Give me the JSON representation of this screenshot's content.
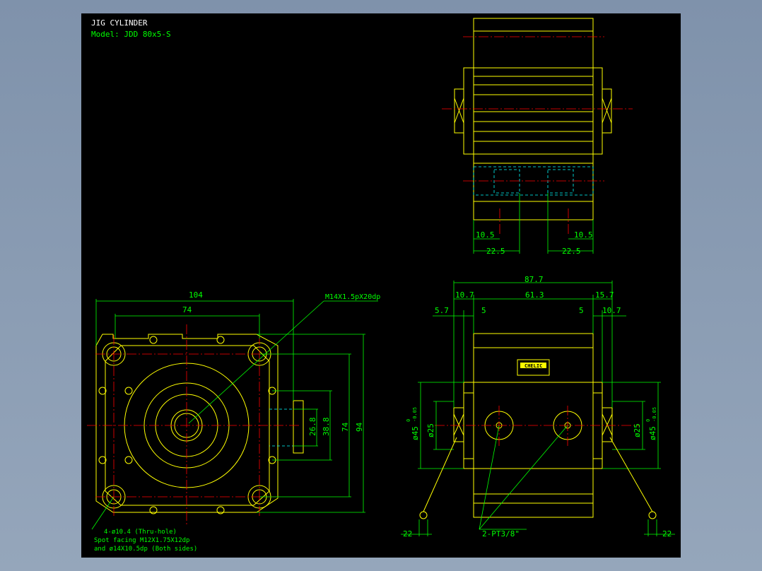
{
  "title": {
    "heading": "JIG CYLINDER",
    "model": "Model:  JDD 80x5-S"
  },
  "colors": {
    "outline": "#ffff00",
    "dimension": "#00ff00",
    "centerline": "#ff0000",
    "hidden": "#00ffff",
    "background": "#000000"
  },
  "top_right_view": {
    "dim_left_inner": "10.5",
    "dim_left_outer": "22.5",
    "dim_right_inner": "10.5",
    "dim_right_outer": "22.5"
  },
  "front_view": {
    "dim_width_total": "104",
    "dim_width_bolt": "74",
    "dim_h_26": "26.8",
    "dim_h_38": "38.8",
    "dim_h_74": "74",
    "dim_h_94": "94",
    "leader_thread": "M14X1.5pX20dp",
    "note_line1": "4-ø10.4 (Thru-hole)",
    "note_line2": "Spot facing  M12X1.75X12dp",
    "note_line3": "and ø14X10.5dp (Both sides)"
  },
  "side_view": {
    "dim_total": "87.7",
    "dim_left": "10.7",
    "dim_mid": "61.3",
    "dim_right": "15.7",
    "dim_5_7": "5.7",
    "dim_5_left": "5",
    "dim_5_right": "5",
    "dim_10_7": "10.7",
    "dia_left_25": "ø25",
    "dia_left_45": "ø45",
    "dia_right_25": "ø25",
    "dia_right_45": "ø45",
    "tol_hi": "0",
    "tol_lo": "-0.05",
    "port_label": "2-PT3/8\"",
    "dim_22_left": "22",
    "dim_22_right": "22",
    "label_brand": "CHELIC"
  }
}
